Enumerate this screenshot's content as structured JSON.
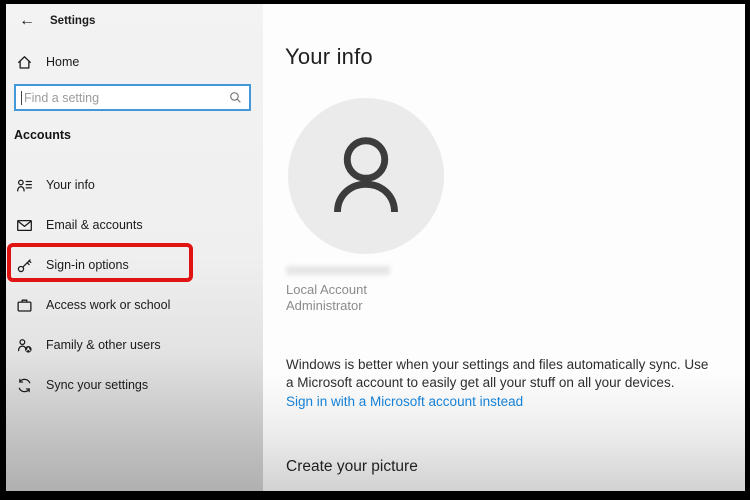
{
  "window": {
    "title": "Settings"
  },
  "sidebar": {
    "back_label": "←",
    "home_label": "Home",
    "search": {
      "placeholder": "Find a setting"
    },
    "section_label": "Accounts",
    "items": [
      {
        "label": "Your info",
        "icon": "contact-card-icon"
      },
      {
        "label": "Email & accounts",
        "icon": "envelope-icon"
      },
      {
        "label": "Sign-in options",
        "icon": "key-icon",
        "highlighted": true
      },
      {
        "label": "Access work or school",
        "icon": "briefcase-icon"
      },
      {
        "label": "Family & other users",
        "icon": "family-icon"
      },
      {
        "label": "Sync your settings",
        "icon": "sync-icon"
      }
    ]
  },
  "main": {
    "title": "Your info",
    "account_name": "Local Account",
    "account_role": "Administrator",
    "sync_text": "Windows is better when your settings and files automatically sync. Use a Microsoft account to easily get all your stuff on all your devices.",
    "link_text": "Sign in with a Microsoft account instead",
    "section_heading": "Create your picture"
  },
  "colors": {
    "search_accent_blue": "#4399d8",
    "highlight_red": "#e01212",
    "link_blue": "#1581d6",
    "avatar_bg": "#ebebeb"
  }
}
